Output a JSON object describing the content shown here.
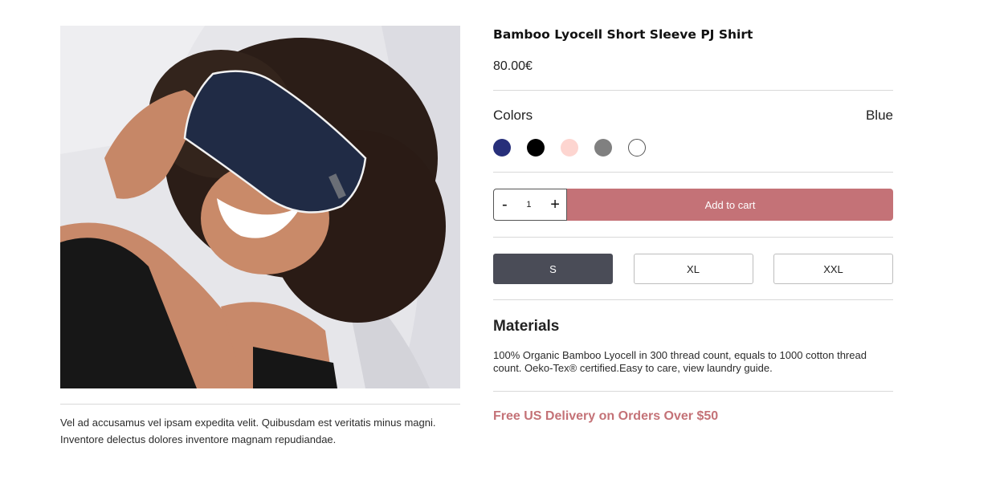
{
  "product": {
    "title": "Bamboo Lyocell Short Sleeve PJ Shirt",
    "price": "80.00€",
    "image_name": "product-photo",
    "description": "Vel ad accusamus vel ipsam expedita velit. Quibusdam est veritatis minus magni. Inventore delectus dolores inventore magnam repudiandae."
  },
  "colors": {
    "label": "Colors",
    "selected": "Blue",
    "swatches": [
      "#272f7a",
      "#000000",
      "#fdd5d0",
      "#808080",
      "#ffffff"
    ]
  },
  "cart": {
    "minus": "-",
    "quantity": "1",
    "plus": "+",
    "add_label": "Add to cart",
    "accent": "#c47277"
  },
  "sizes": {
    "options": [
      "S",
      "XL",
      "XXL"
    ],
    "selected": "S"
  },
  "materials": {
    "title": "Materials",
    "text": "100% Organic Bamboo Lyocell in 300 thread count, equals to 1000 cotton thread count. Oeko-Tex® certified.Easy to care, view laundry guide."
  },
  "delivery": {
    "text": "Free US Delivery on Orders Over $50"
  }
}
